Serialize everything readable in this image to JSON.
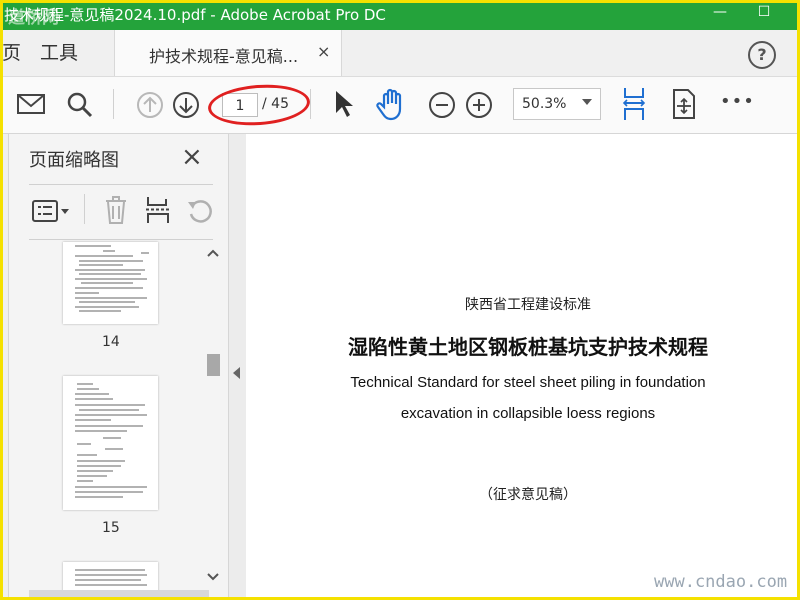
{
  "window": {
    "title": "技术规程-意见稿2024.10.pdf - Adobe Acrobat Pro DC",
    "minimize": "—",
    "maximize": "☐"
  },
  "watermark_top": "道桥网",
  "watermark_bottom": "www.cndao.com",
  "tabs": {
    "home_partial": "页",
    "tools": "工具",
    "document": "护技术规程-意见稿...",
    "close": "×",
    "help": "?"
  },
  "toolbar": {
    "page_current": "1",
    "page_total": "/ 45",
    "zoom": "50.3%",
    "more": "•••"
  },
  "thumbnails_panel": {
    "title": "页面缩略图",
    "close": "×",
    "pages": [
      {
        "label": "14"
      },
      {
        "label": "15"
      }
    ]
  },
  "document": {
    "org": "陕西省工程建设标准",
    "title_cn": "湿陷性黄土地区钢板桩基坑支护技术规程",
    "title_en_line1": "Technical Standard for steel sheet piling in foundation",
    "title_en_line2": "excavation in collapsible loess regions",
    "draft": "（征求意见稿）"
  },
  "colors": {
    "titlebar": "#24a33b",
    "accent": "#1f6fd1",
    "frame": "#f5e100",
    "annotation": "#e02020"
  }
}
